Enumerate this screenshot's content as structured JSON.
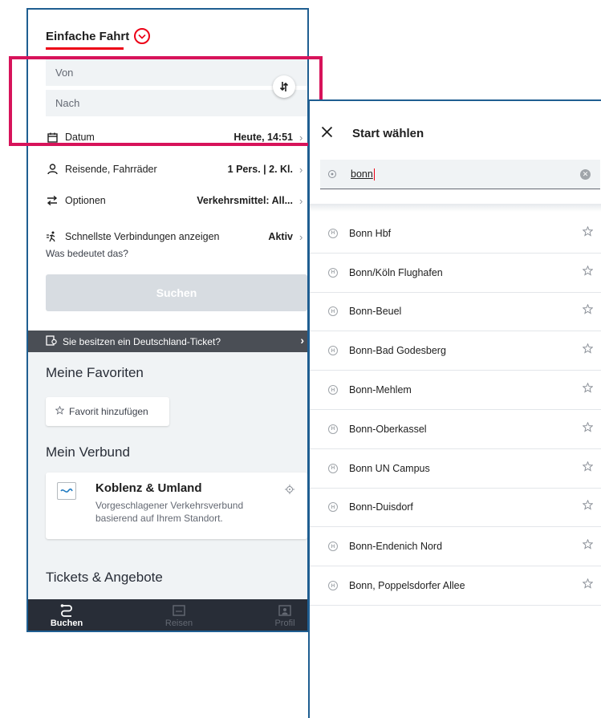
{
  "left_screen": {
    "trip_type": "Einfache Fahrt",
    "from_placeholder": "Von",
    "to_placeholder": "Nach",
    "datum_label": "Datum",
    "datum_value": "Heute, 14:51",
    "reisende_label": "Reisende, Fahrräder",
    "reisende_value": "1 Pers. | 2. Kl.",
    "optionen_label": "Optionen",
    "optionen_value": "Verkehrsmittel: All...",
    "schnellste_label": "Schnellste Verbindungen anzeigen",
    "schnellste_value": "Aktiv",
    "schnellste_link": "Was bedeutet das?",
    "search_button": "Suchen",
    "dt_banner": "Sie besitzen ein Deutschland-Ticket?",
    "favorites_title": "Meine Favoriten",
    "add_favorite": "Favorit hinzufügen",
    "verbund_title": "Mein Verbund",
    "verbund_name": "Koblenz & Umland",
    "verbund_desc": "Vorgeschlagener Verkehrsverbund basierend auf Ihrem Standort.",
    "tickets_title": "Tickets & Angebote",
    "nav": {
      "buchen": "Buchen",
      "reisen": "Reisen",
      "profil": "Profil"
    }
  },
  "right_screen": {
    "title": "Start wählen",
    "search_value": "bonn",
    "stations": [
      "Bonn Hbf",
      "Bonn/Köln Flughafen",
      "Bonn-Beuel",
      "Bonn-Bad Godesberg",
      "Bonn-Mehlem",
      "Bonn-Oberkassel",
      "Bonn UN Campus",
      "Bonn-Duisdorf",
      "Bonn-Endenich Nord",
      "Bonn, Poppelsdorfer Allee"
    ]
  },
  "colors": {
    "accent": "#ec0016",
    "highlight": "#d7135a",
    "frame": "#1f5e91",
    "nav_bg": "#282d37"
  }
}
